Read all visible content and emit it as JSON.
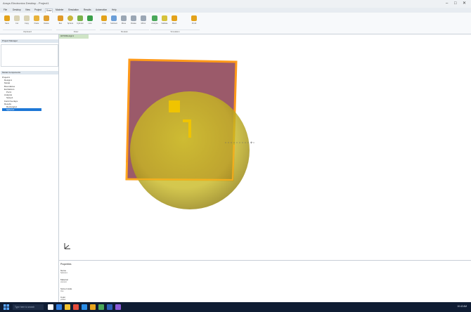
{
  "window": {
    "title": "Ansys Electronics Desktop - Project1",
    "controls": [
      "–",
      "□",
      "✕"
    ]
  },
  "menu_tabs": [
    {
      "label": "File",
      "active": false
    },
    {
      "label": "Desktop",
      "active": false
    },
    {
      "label": "View",
      "active": false
    },
    {
      "label": "Project",
      "active": false
    },
    {
      "label": "Draw",
      "active": true
    },
    {
      "label": "Modeler",
      "active": false
    },
    {
      "label": "Simulation",
      "active": false
    },
    {
      "label": "Results",
      "active": false
    },
    {
      "label": "Automation",
      "active": false
    },
    {
      "label": "Help",
      "active": false
    }
  ],
  "ribbon": {
    "buttons": [
      {
        "label": "Save",
        "color": "#e3a21a"
      },
      {
        "label": "Cut",
        "color": "#d9d2b4"
      },
      {
        "label": "Copy",
        "color": "#d9d2b4"
      },
      {
        "label": "Paste",
        "color": "#e8b23a"
      },
      {
        "label": "Delete",
        "color": "#e0a030"
      },
      {
        "label": "Box",
        "color": "#e09a28"
      },
      {
        "label": "Sphere",
        "color": "#c9b53a"
      },
      {
        "label": "Cylinder",
        "color": "#7ab24a"
      },
      {
        "label": "Line",
        "color": "#3aa04a"
      },
      {
        "label": "Unite",
        "color": "#e3a21a"
      },
      {
        "label": "Subtract",
        "color": "#6a9ed8"
      },
      {
        "label": "Move",
        "color": "#9aa6b4"
      },
      {
        "label": "Rotate",
        "color": "#9aa6b4"
      },
      {
        "label": "Mirror",
        "color": "#9aa6b4"
      },
      {
        "label": "Analyze",
        "color": "#4aa85a"
      },
      {
        "label": "Validate",
        "color": "#d6c23a"
      },
      {
        "label": "Mesh",
        "color": "#e3a21a"
      },
      {
        "label": "Fit All",
        "color": "#e3a21a"
      }
    ],
    "groups": [
      "Clipboard",
      "Draw",
      "Modeler",
      "Simulation"
    ]
  },
  "project_manager": {
    "header": "Project Manager",
    "tree_header": "Model Components",
    "tree": [
      {
        "label": "Project1",
        "depth": 0
      },
      {
        "label": "Design1",
        "depth": 1
      },
      {
        "label": "Model",
        "depth": 1
      },
      {
        "label": "Boundaries",
        "depth": 1
      },
      {
        "label": "Excitations",
        "depth": 1
      },
      {
        "label": "Port1",
        "depth": 2
      },
      {
        "label": "Analysis",
        "depth": 1
      },
      {
        "label": "Setup1",
        "depth": 2
      },
      {
        "label": "Field Overlays",
        "depth": 1
      },
      {
        "label": "Results",
        "depth": 1
      },
      {
        "label": "Rectangle1",
        "depth": 2
      },
      {
        "label": "Sphere1",
        "depth": 2,
        "selected": true
      }
    ]
  },
  "viewport": {
    "tab_label": "HFSSDesign1",
    "objects": {
      "sphere_color": "#d8cf28",
      "plate_color": "#9b5a6a",
      "outline_color": "#ff9a1a"
    }
  },
  "info_panel": {
    "heading": "Properties",
    "items": [
      {
        "name": "Name",
        "value": "Sphere1"
      },
      {
        "name": "Material",
        "value": "vacuum"
      },
      {
        "name": "Solve Inside",
        "value": "true"
      },
      {
        "name": "Color",
        "value": "yellow"
      }
    ]
  },
  "taskbar": {
    "search_placeholder": "Type here to search",
    "time": "10:42 AM"
  }
}
